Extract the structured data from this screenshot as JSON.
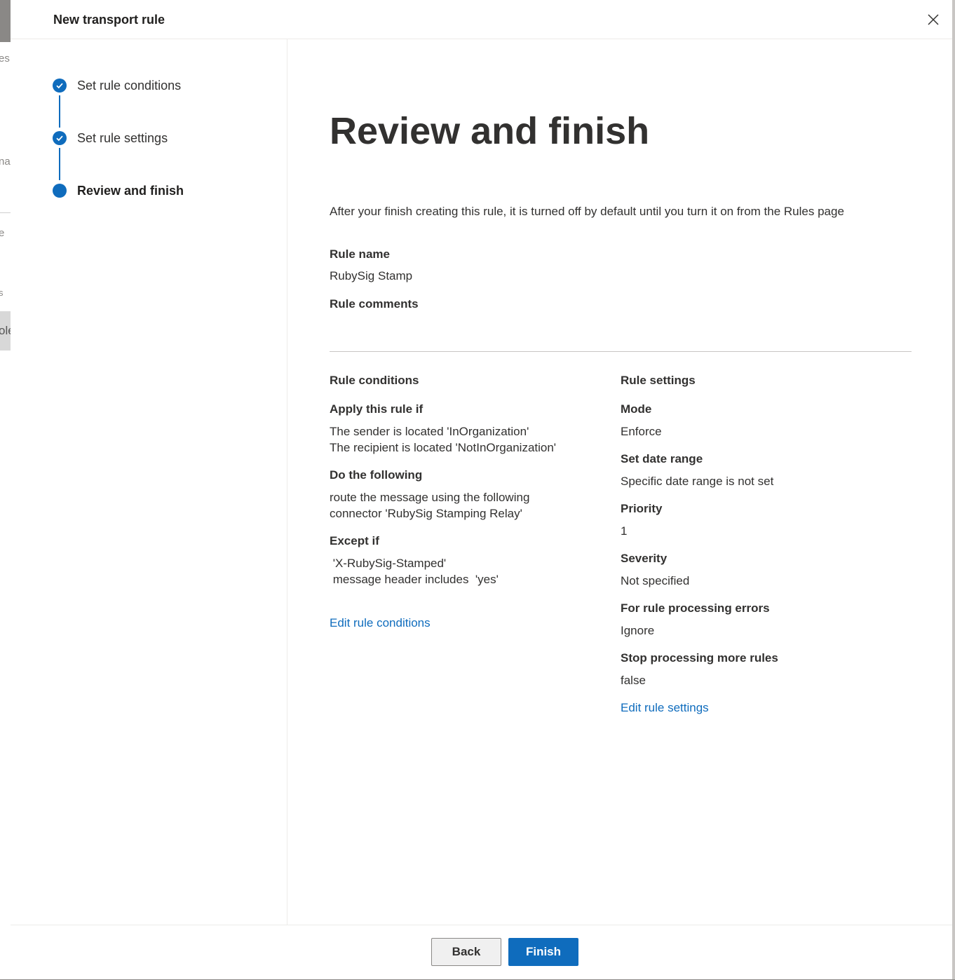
{
  "background": {
    "fragments": [
      "es",
      "na",
      "e",
      "s",
      "ole"
    ]
  },
  "panel": {
    "title": "New transport rule",
    "close_icon": "close-icon"
  },
  "steps": [
    {
      "label": "Set rule conditions",
      "state": "completed"
    },
    {
      "label": "Set rule settings",
      "state": "completed"
    },
    {
      "label": "Review and finish",
      "state": "current"
    }
  ],
  "review": {
    "title": "Review and finish",
    "intro": "After your finish creating this rule, it is turned off by default until you turn it on from the Rules page",
    "rule_name_label": "Rule name",
    "rule_name_value": "RubySig Stamp",
    "rule_comments_label": "Rule comments",
    "conditions": {
      "heading": "Rule conditions",
      "apply_label": "Apply this rule if",
      "apply_lines": [
        "The sender is located 'InOrganization'",
        "The recipient is located 'NotInOrganization'"
      ],
      "do_label": "Do the following",
      "do_lines": [
        "route the message using the following",
        "connector 'RubySig Stamping Relay'"
      ],
      "except_label": "Except if",
      "except_lines": [
        " 'X-RubySig-Stamped'",
        " message header includes  'yes'"
      ],
      "edit_link": "Edit rule conditions"
    },
    "settings": {
      "heading": "Rule settings",
      "mode_label": "Mode",
      "mode_value": "Enforce",
      "date_label": "Set date range",
      "date_value": "Specific date range is not set",
      "priority_label": "Priority",
      "priority_value": "1",
      "severity_label": "Severity",
      "severity_value": "Not specified",
      "errors_label": "For rule processing errors",
      "errors_value": "Ignore",
      "stop_label": "Stop processing more rules",
      "stop_value": "false",
      "edit_link": "Edit rule settings"
    }
  },
  "footer": {
    "back_label": "Back",
    "finish_label": "Finish"
  },
  "colors": {
    "accent": "#0f6cbd",
    "text": "#323130",
    "divider": "#c8c6c4"
  }
}
